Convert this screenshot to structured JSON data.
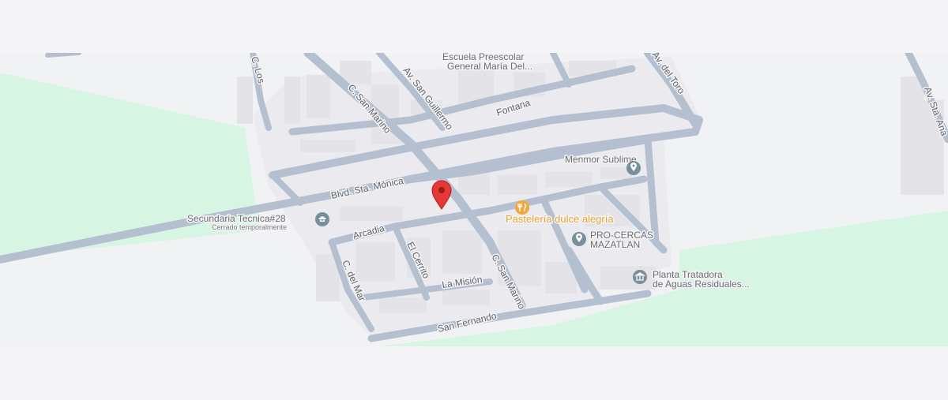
{
  "colors": {
    "page_background": "#f5f4f6",
    "map_background": "#f1f2f4",
    "park": "#d6f5e3",
    "road": "#b4c0cf",
    "road_casing": "#a7b4c4",
    "building": "#e3e3e8",
    "marker_red": "#e53935",
    "food_orange": "#f2a63b",
    "poi_gray": "#78909c"
  },
  "streets": {
    "san_marino_north": "C. San Marino",
    "san_marino_south": "C. San Marino",
    "san_guillermo": "Av. San Guillermo",
    "fontana": "Fontana",
    "santa_monica": "Blvd. Sta. Mónica",
    "arcadia": "Arcadia",
    "el_cerrito": "El Cerrito",
    "la_mision": "La Misión",
    "san_fernando": "San Fernando",
    "c_del_mar": "C. del Mar",
    "del_toro": "Av. del Toro",
    "top_left_street": "C. Los",
    "right_edge_street": "Av. Sta. Ana"
  },
  "places": {
    "escuela": {
      "name_line1": "Escuela Preescolar",
      "name_line2": "General María Del..."
    },
    "menmor": {
      "name": "Menmor Sublime",
      "icon": "pin-icon"
    },
    "pasteleria": {
      "name": "Pastelería dulce alegría",
      "icon": "restaurant-icon"
    },
    "secundaria": {
      "name": "Secundaria Tecnica#28",
      "status": "Cerrado temporalmente",
      "icon": "school-icon"
    },
    "pro_cercas": {
      "name_line1": "PRO-CERCAS",
      "name_line2": "MAZATLAN",
      "icon": "pin-icon"
    },
    "planta": {
      "name_line1": "Planta Tratadora",
      "name_line2": "de Aguas Residuales...",
      "icon": "landmark-icon"
    }
  },
  "marker": {
    "icon": "location-marker-icon",
    "color": "#e53935"
  }
}
